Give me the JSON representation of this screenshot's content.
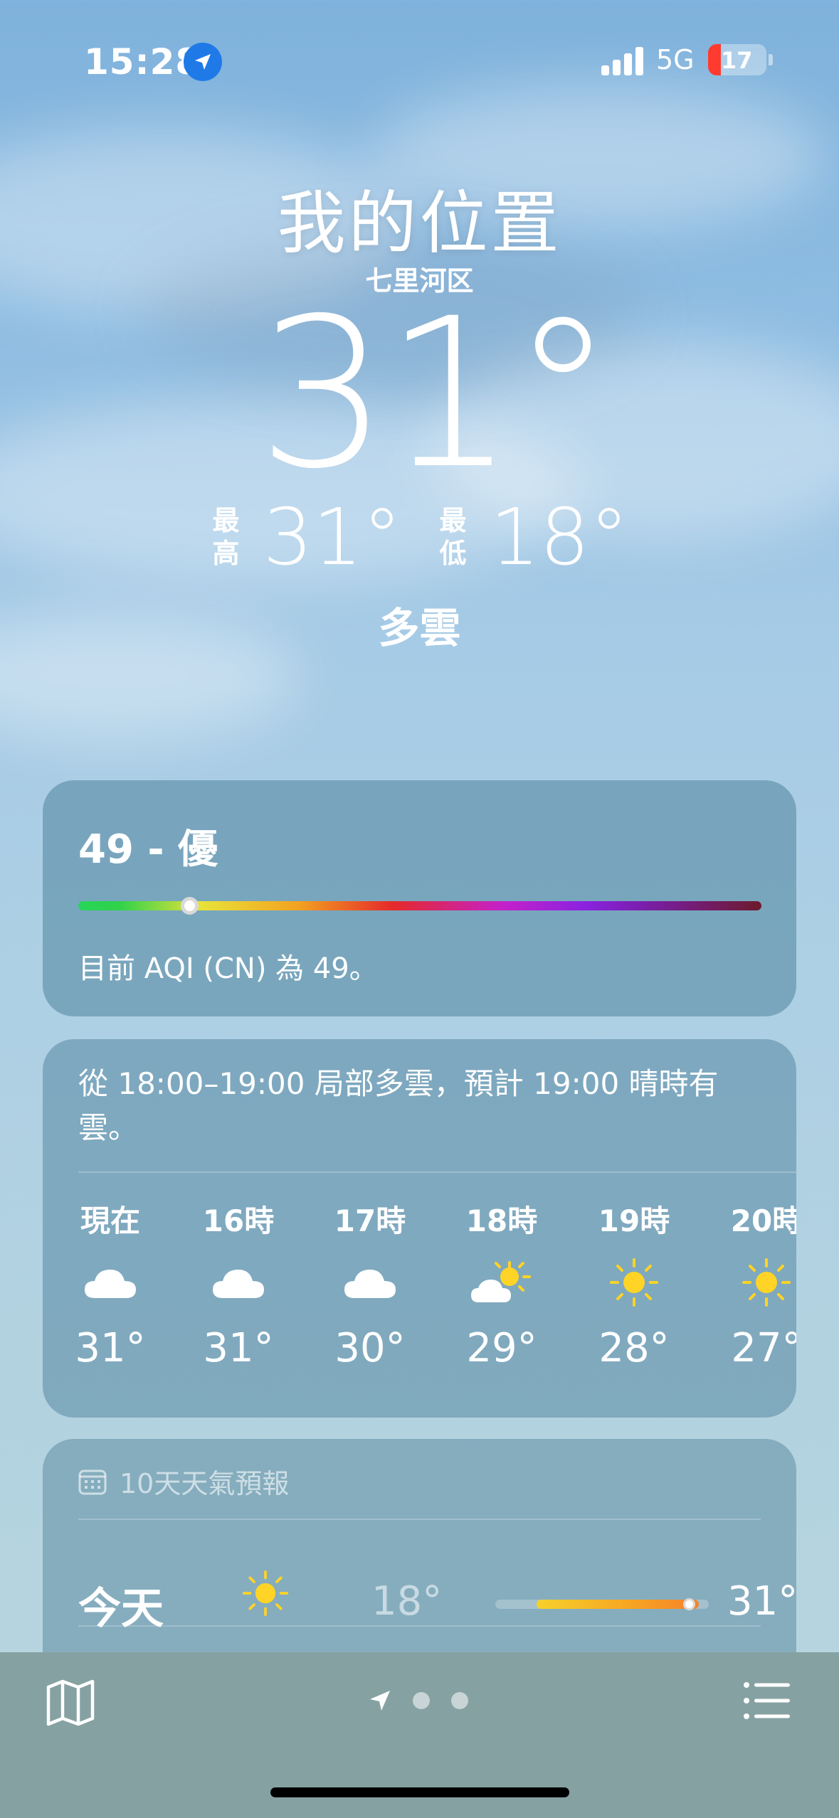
{
  "status_bar": {
    "time": "15:28",
    "network": "5G",
    "battery": "17"
  },
  "header": {
    "title": "我的位置",
    "district": "七里河区",
    "temperature": "31°",
    "high_label": "最高",
    "high": "31°",
    "low_label": "最低",
    "low": "18°",
    "condition": "多雲"
  },
  "aqi": {
    "title": "49 - 優",
    "level": 49,
    "description": "目前 AQI (CN) 為 49。"
  },
  "hourly": {
    "summary": "從 18:00–19:00 局部多雲，預計 19:00 晴時有雲。",
    "items": [
      {
        "hour": "現在",
        "icon": "cloud-icon",
        "temp": "31°"
      },
      {
        "hour": "16時",
        "icon": "cloud-icon",
        "temp": "31°"
      },
      {
        "hour": "17時",
        "icon": "cloud-icon",
        "temp": "30°"
      },
      {
        "hour": "18時",
        "icon": "partly-sunny-icon",
        "temp": "29°"
      },
      {
        "hour": "19時",
        "icon": "sun-icon",
        "temp": "28°"
      },
      {
        "hour": "20時",
        "icon": "sun-icon",
        "temp": "27°"
      }
    ]
  },
  "daily": {
    "header": "10天天氣預報",
    "rows": [
      {
        "day": "今天",
        "icon": "sun-icon",
        "low": "18°",
        "high": "31°"
      }
    ]
  },
  "colors": {
    "sun": "#FFD426",
    "location_badge": "#1F7AE8",
    "battery_low": "#FF3B30"
  }
}
